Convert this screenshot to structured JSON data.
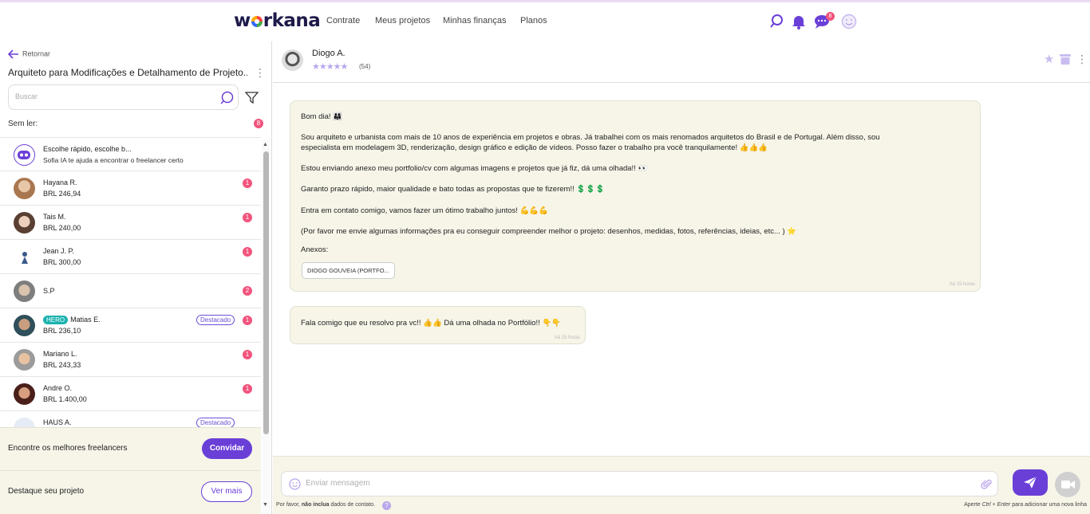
{
  "topnav": {
    "logo": "workana",
    "links": [
      "Contrate",
      "Meus projetos",
      "Minhas finanças",
      "Planos"
    ],
    "chat_badge": "8"
  },
  "sidebar": {
    "back_label": "Retornar",
    "project_title": "Arquiteto para Modificações e Detalhamento de Projeto...",
    "search_placeholder": "Buscar",
    "unread_label": "Sem ler:",
    "unread_count": "8",
    "sofia": {
      "title": "Escolhe rápido, escolhe b...",
      "subtitle": "Sofia IA te ajuda a encontrar o freelancer certo"
    },
    "freelancers": [
      {
        "name": "Hayana R.",
        "price": "BRL 246,94",
        "badge": "1",
        "highlight": "",
        "hero": ""
      },
      {
        "name": "Tais M.",
        "price": "BRL 240,00",
        "badge": "1",
        "highlight": "",
        "hero": ""
      },
      {
        "name": "Jean J. P.",
        "price": "BRL 300,00",
        "badge": "1",
        "highlight": "",
        "hero": ""
      },
      {
        "name": "S.P",
        "price": "",
        "badge": "2",
        "highlight": "",
        "hero": ""
      },
      {
        "name": "Matias E.",
        "price": "BRL 236,10",
        "badge": "1",
        "highlight": "Destacado",
        "hero": "HERO"
      },
      {
        "name": "Mariano L.",
        "price": "BRL 243,33",
        "badge": "1",
        "highlight": "",
        "hero": ""
      },
      {
        "name": "Andre O.",
        "price": "BRL 1.400,00",
        "badge": "1",
        "highlight": "",
        "hero": ""
      },
      {
        "name": "HAUS A.",
        "price": "",
        "badge": "",
        "highlight": "Destacado",
        "hero": ""
      }
    ],
    "promo1": {
      "text": "Encontre os melhores freelancers",
      "button": "Convidar"
    },
    "promo2": {
      "text": "Destaque seu projeto",
      "button": "Ver mais"
    }
  },
  "chat": {
    "contact_name": "Diogo A.",
    "rating_count": "(54)",
    "message1": {
      "lines": [
        "Bom dia! 👨‍👩‍👧",
        "Sou arquiteto e urbanista com mais de 10 anos de experiência em projetos e obras. Já trabalhei com os mais renomados arquitetos do Brasil e de Portugal. Além disso, sou",
        "especialista em modelagem 3D, renderização, design gráfico e edição de vídeos. Posso fazer o trabalho pra você tranquilamente! 👍👍👍",
        "Estou enviando anexo meu portfolio/cv com algumas imagens e projetos que já fiz, dá uma olhada!! 👀",
        "Garanto prazo rápido, maior qualidade e bato todas as propostas que te fizerem!! 💲💲💲",
        "Entra em contato comigo, vamos fazer um ótimo trabalho juntos! 💪💪💪",
        "(Por favor me envie algumas informações pra eu conseguir compreender melhor o projeto: desenhos, medidas, fotos, referências, ideias, etc... ) ⭐"
      ],
      "attachments_label": "Anexos:",
      "attachment": "DIOGO GOUVEIA (PORTFO...",
      "time": "há 15 horas"
    },
    "message2": {
      "text": "Fala comigo que eu resolvo pra vc!! 👍👍 Dá uma olhada no Portfólio!! 👇👇",
      "time": "há 15 horas"
    },
    "composer": {
      "placeholder": "Enviar mensagem",
      "hint_prefix": "Por favor, ",
      "hint_bold": "não inclua",
      "hint_suffix": " dados de contato.",
      "hint_right_prefix": "Aperte ",
      "hint_right_keys": "Ctrl + Enter",
      "hint_right_suffix": " para adicionar uma nova linha"
    }
  },
  "colors": {
    "brand": "#6a3fd8",
    "badge": "#f2547d",
    "bubble": "#f6f5e8",
    "hero": "#1bb3b0"
  }
}
